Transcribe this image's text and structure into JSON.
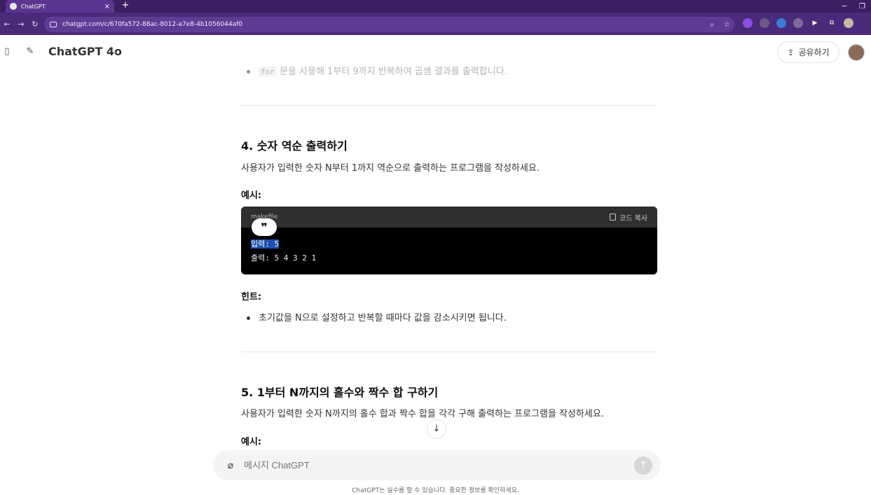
{
  "browser": {
    "tab_title": "ChatGPT",
    "tab_close": "×",
    "new_tab": "+",
    "url": "chatgpt.com/c/670fa572-88ac-8012-a7e8-4b1056044af0"
  },
  "header": {
    "model_name": "ChatGPT 4o",
    "share_label": "공유하기"
  },
  "content": {
    "faded_bullet_code": "for",
    "faded_bullet_text": " 문을 사용해 1부터 9까지 반복하여 곱셈 결과를 출력합니다.",
    "section4": {
      "title": "4. 숫자 역순 출력하기",
      "description": "사용자가 입력한 숫자 N부터 1까지 역순으로 출력하는 프로그램을 작성하세요.",
      "example_label": "예시:",
      "code": {
        "language": "makefile",
        "copy_label": "코드 복사",
        "quote_glyph": "❞",
        "line1_selected": "입력: 5",
        "line2": "출력: 5 4 3 2 1"
      },
      "hint_label": "힌트:",
      "hint_bullet": "초기값을 N으로 설정하고 반복할 때마다 값을 감소시키면 됩니다."
    },
    "section5": {
      "title": "5. 1부터 N까지의 홀수와 짝수 합 구하기",
      "description": "사용자가 입력한 숫자 N까지의 홀수 합과 짝수 합을 각각 구해 출력하는 프로그램을 작성하세요.",
      "example_label": "예시:"
    }
  },
  "composer": {
    "placeholder": "메시지 ChatGPT"
  },
  "footer": {
    "disclaimer": "ChatGPT는 실수를 할 수 있습니다. 중요한 정보를 확인하세요."
  }
}
